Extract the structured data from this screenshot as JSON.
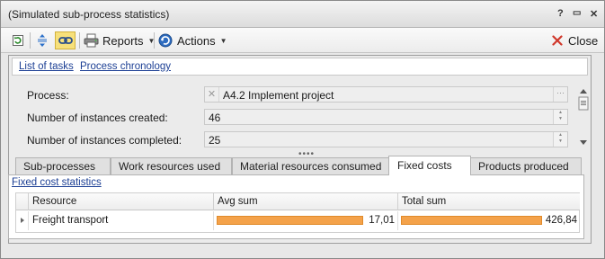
{
  "window": {
    "title": "(Simulated sub-process statistics)",
    "controls": {
      "help": "?",
      "minimize": "▭",
      "close": "✕"
    }
  },
  "toolbar": {
    "reports_label": "Reports",
    "actions_label": "Actions",
    "close_label": "Close"
  },
  "links": {
    "tasks": "List of tasks",
    "chronology": "Process chronology"
  },
  "form": {
    "process_label": "Process:",
    "process_value": "A4.2 Implement project",
    "created_label": "Number of instances created:",
    "created_value": "46",
    "completed_label": "Number of instances completed:",
    "completed_value": "25"
  },
  "tabs": [
    {
      "label": "Sub-processes"
    },
    {
      "label": "Work resources used"
    },
    {
      "label": "Material resources consumed"
    },
    {
      "label": "Fixed costs"
    },
    {
      "label": "Products produced"
    }
  ],
  "active_tab": "Fixed costs",
  "grid": {
    "title": "Fixed cost statistics",
    "columns": [
      "Resource",
      "Avg sum",
      "Total sum"
    ],
    "rows": [
      {
        "resource": "Freight transport",
        "avg_sum": "17,01",
        "avg_fill": 1.0,
        "total_sum": "426,84",
        "total_fill": 1.0
      }
    ]
  },
  "colors": {
    "bar": "#f4a24a",
    "link": "#1c3f94",
    "close_icon": "#d0382b"
  }
}
